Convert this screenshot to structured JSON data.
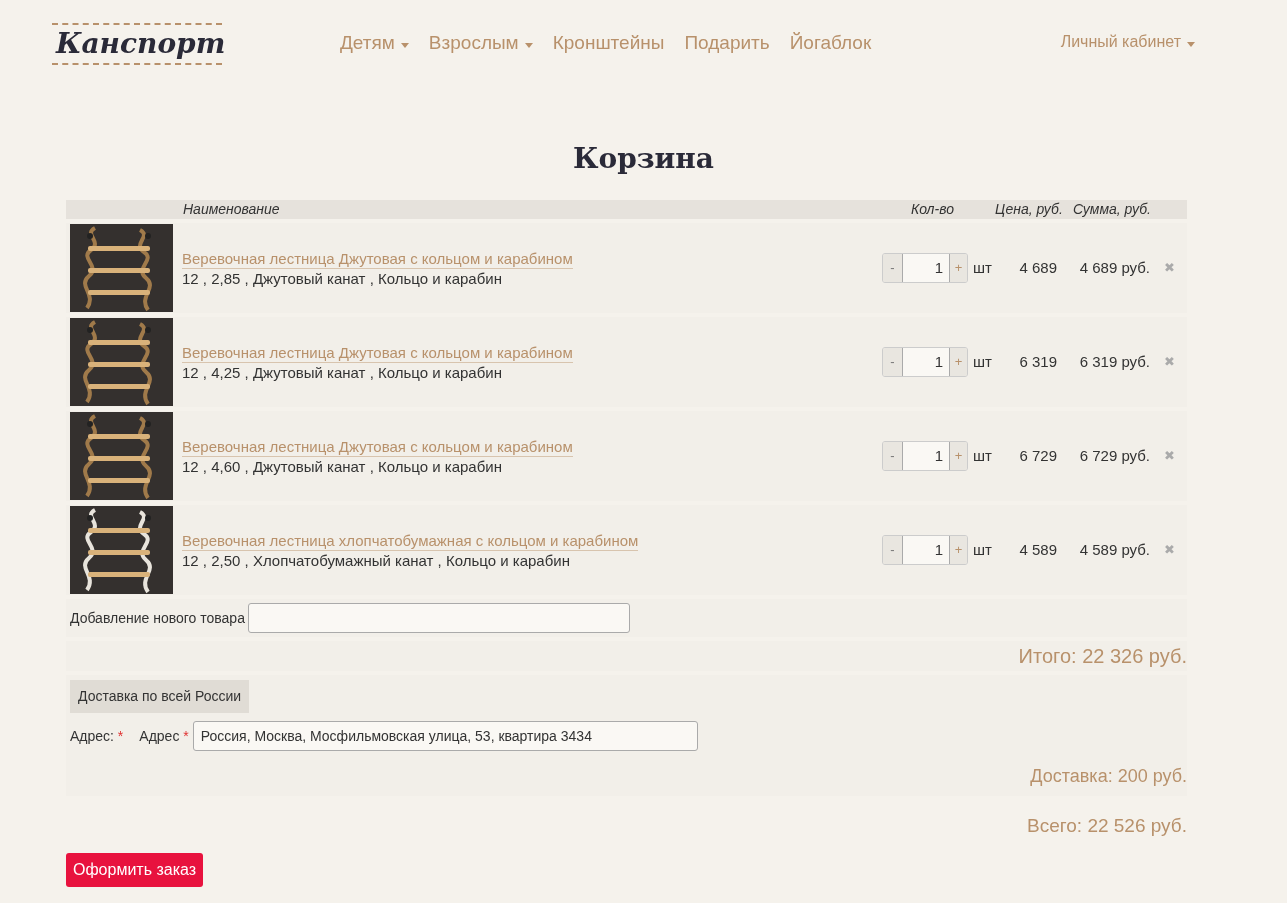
{
  "logo": "Канспорт",
  "nav": [
    {
      "label": "Детям",
      "dropdown": true
    },
    {
      "label": "Взрослым",
      "dropdown": true
    },
    {
      "label": "Кронштейны",
      "dropdown": false
    },
    {
      "label": "Подарить",
      "dropdown": false
    },
    {
      "label": "Йогаблок",
      "dropdown": false
    }
  ],
  "account": {
    "label": "Личный кабинет",
    "dropdown": true
  },
  "title": "Корзина",
  "table": {
    "columns": [
      "Наименование",
      "Кол-во",
      "Цена, руб.",
      "Сумма, руб."
    ],
    "rows": [
      {
        "name": "Веревочная лестница Джутовая с кольцом и карабином",
        "details": "12 , 2,85 , Джутовый канат , Кольцо и карабин",
        "minus": "-",
        "qty": "1",
        "plus": "+",
        "unit": "шт",
        "price": "4 689",
        "sum": "4 689 руб.",
        "remove": "✖"
      },
      {
        "name": "Веревочная лестница Джутовая с кольцом и карабином",
        "details": "12 , 4,25 , Джутовый канат , Кольцо и карабин",
        "minus": "-",
        "qty": "1",
        "plus": "+",
        "unit": "шт",
        "price": "6 319",
        "sum": "6 319 руб.",
        "remove": "✖"
      },
      {
        "name": "Веревочная лестница Джутовая с кольцом и карабином",
        "details": "12 , 4,60 , Джутовый канат , Кольцо и карабин",
        "minus": "-",
        "qty": "1",
        "plus": "+",
        "unit": "шт",
        "price": "6 729",
        "sum": "6 729 руб.",
        "remove": "✖"
      },
      {
        "name": "Веревочная лестница хлопчатобумажная с кольцом и карабином",
        "details": "12 , 2,50 , Хлопчатобумажный канат , Кольцо и карабин",
        "minus": "-",
        "qty": "1",
        "plus": "+",
        "unit": "шт",
        "price": "4 589",
        "sum": "4 589 руб.",
        "remove": "✖"
      }
    ]
  },
  "add_item": {
    "label": "Добавление нового товара"
  },
  "subtotal": "Итого: 22 326 руб.",
  "delivery": {
    "tab": "Доставка по всей России",
    "address_label": "Адрес:",
    "required_mark": "*",
    "field_label": "Адрес",
    "field_required_mark": "*",
    "address": "Россия, Москва, Мосфильмовская улица, 53, квартира 3434",
    "cost": "Доставка: 200 руб."
  },
  "total": "Всего: 22 526 руб.",
  "checkout": "Оформить заказ"
}
